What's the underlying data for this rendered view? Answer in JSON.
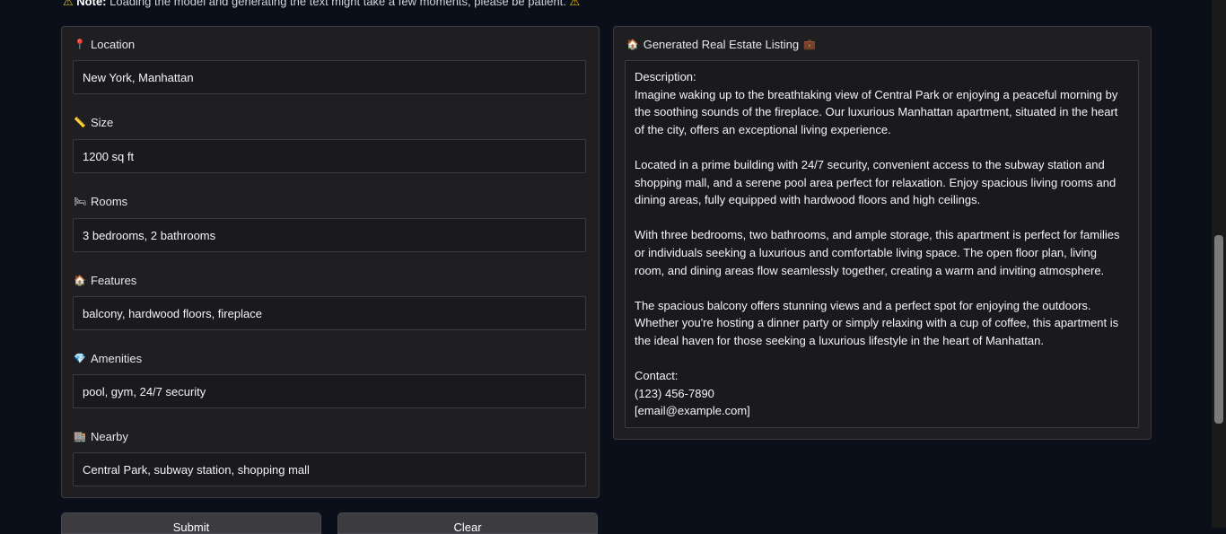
{
  "note": {
    "bold": "Note:",
    "text": "Loading the model and generating the text might take a few moments, please be patient."
  },
  "inputs": {
    "location": {
      "icon": "📍",
      "label": "Location",
      "value": "New York, Manhattan"
    },
    "size": {
      "icon": "📏",
      "label": "Size",
      "value": "1200 sq ft"
    },
    "rooms": {
      "icon": "🛏",
      "label": "Rooms",
      "value": "3 bedrooms, 2 bathrooms"
    },
    "features": {
      "icon": "🏠",
      "label": "Features",
      "value": "balcony, hardwood floors, fireplace"
    },
    "amenities": {
      "icon": "💎",
      "label": "Amenities",
      "value": "pool, gym, 24/7 security"
    },
    "nearby": {
      "icon": "🏬",
      "label": "Nearby",
      "value": "Central Park, subway station, shopping mall"
    }
  },
  "output": {
    "icon": "🏠",
    "icon2": "💼",
    "label": "Generated Real Estate Listing",
    "description_header": "Description:",
    "para1": "Imagine waking up to the breathtaking view of Central Park or enjoying a peaceful morning by the soothing sounds of the fireplace. Our luxurious Manhattan apartment, situated in the heart of the city, offers an exceptional living experience.",
    "para2": "Located in a prime building with 24/7 security, convenient access to the subway station and shopping mall, and a serene pool area perfect for relaxation. Enjoy spacious living rooms and dining areas, fully equipped with hardwood floors and high ceilings.",
    "para3": "With three bedrooms, two bathrooms, and ample storage, this apartment is perfect for families or individuals seeking a luxurious and comfortable living space. The open floor plan, living room, and dining areas flow seamlessly together, creating a warm and inviting atmosphere.",
    "para4": "The spacious balcony offers stunning views and a perfect spot for enjoying the outdoors. Whether you're hosting a dinner party or simply relaxing with a cup of coffee, this apartment is the ideal haven for those seeking a luxurious lifestyle in the heart of Manhattan.",
    "contact_header": "Contact:",
    "phone": "(123) 456-7890",
    "email": "[email@example.com]"
  },
  "buttons": {
    "submit": "Submit",
    "clear": "Clear"
  }
}
